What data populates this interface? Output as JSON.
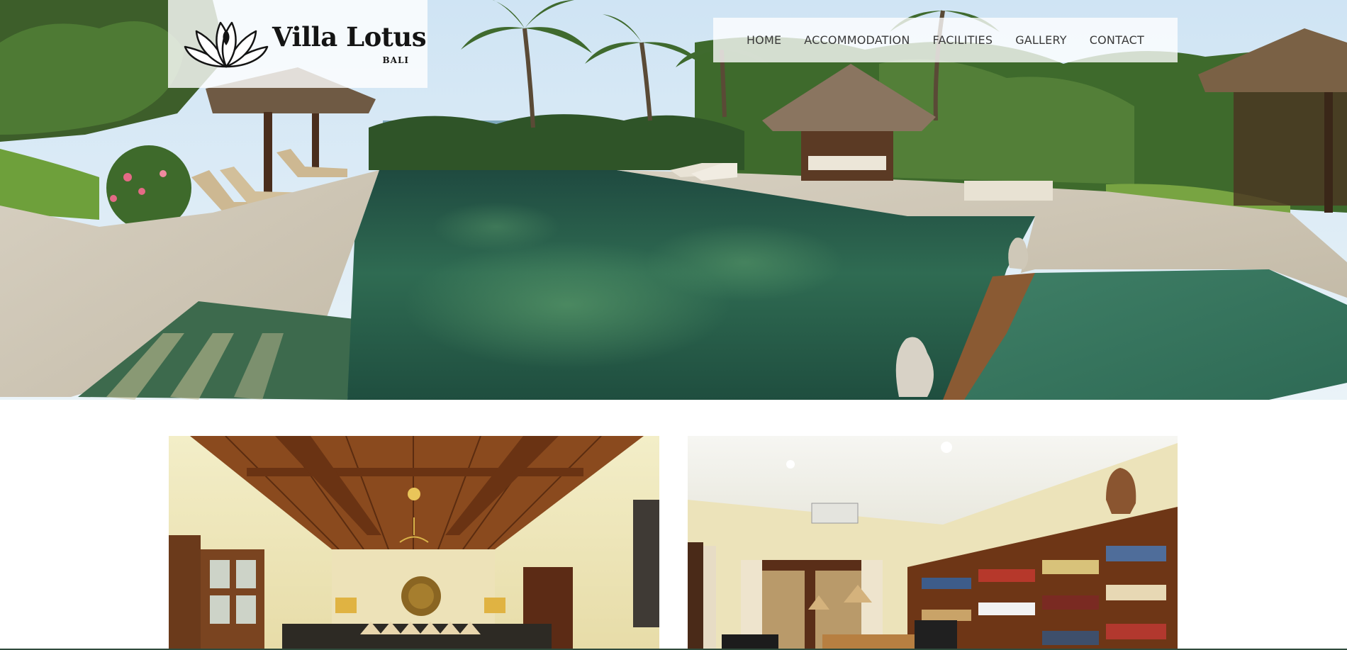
{
  "site": {
    "logo_name": "Villa Lotus",
    "logo_sub": "BALI"
  },
  "nav": {
    "items": [
      {
        "label": "HOME"
      },
      {
        "label": "ACCOMMODATION"
      },
      {
        "label": "FACILITIES"
      },
      {
        "label": "GALLERY"
      },
      {
        "label": "CONTACT"
      }
    ]
  },
  "hero": {
    "subject": "pool-and-garden-photo"
  },
  "gallery": {
    "left_subject": "living-room-photo",
    "right_subject": "library-room-photo"
  },
  "colors": {
    "nav_text": "#3a3a3a",
    "logo_text": "#141414",
    "pool_green": "#2f6b52",
    "wood_brown": "#7a3e1c",
    "wall_cream": "#efe6b8"
  }
}
